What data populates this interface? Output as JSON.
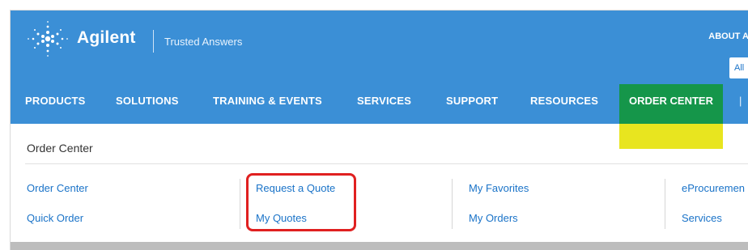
{
  "brand": {
    "name": "Agilent",
    "tagline": "Trusted Answers"
  },
  "utility": {
    "about_label": "ABOUT A",
    "search_scope": "All"
  },
  "nav": {
    "items": [
      {
        "label": "PRODUCTS"
      },
      {
        "label": "SOLUTIONS"
      },
      {
        "label": "TRAINING & EVENTS"
      },
      {
        "label": "SERVICES"
      },
      {
        "label": "SUPPORT"
      },
      {
        "label": "RESOURCES"
      },
      {
        "label": "ORDER CENTER",
        "active": true
      }
    ],
    "separator": "|"
  },
  "panel": {
    "title": "Order Center",
    "columns": [
      {
        "links": [
          "Order Center",
          "Quick Order"
        ]
      },
      {
        "links": [
          "Request a Quote",
          "My Quotes"
        ]
      },
      {
        "links": [
          "My Favorites",
          "My Orders"
        ]
      },
      {
        "links": [
          "eProcuremen",
          "Services"
        ]
      }
    ]
  },
  "colors": {
    "header_blue": "#3b8fd6",
    "active_green": "#15964a",
    "highlight_yellow": "#e8e51f",
    "link_blue": "#1a73c8",
    "callout_red": "#e02020"
  }
}
